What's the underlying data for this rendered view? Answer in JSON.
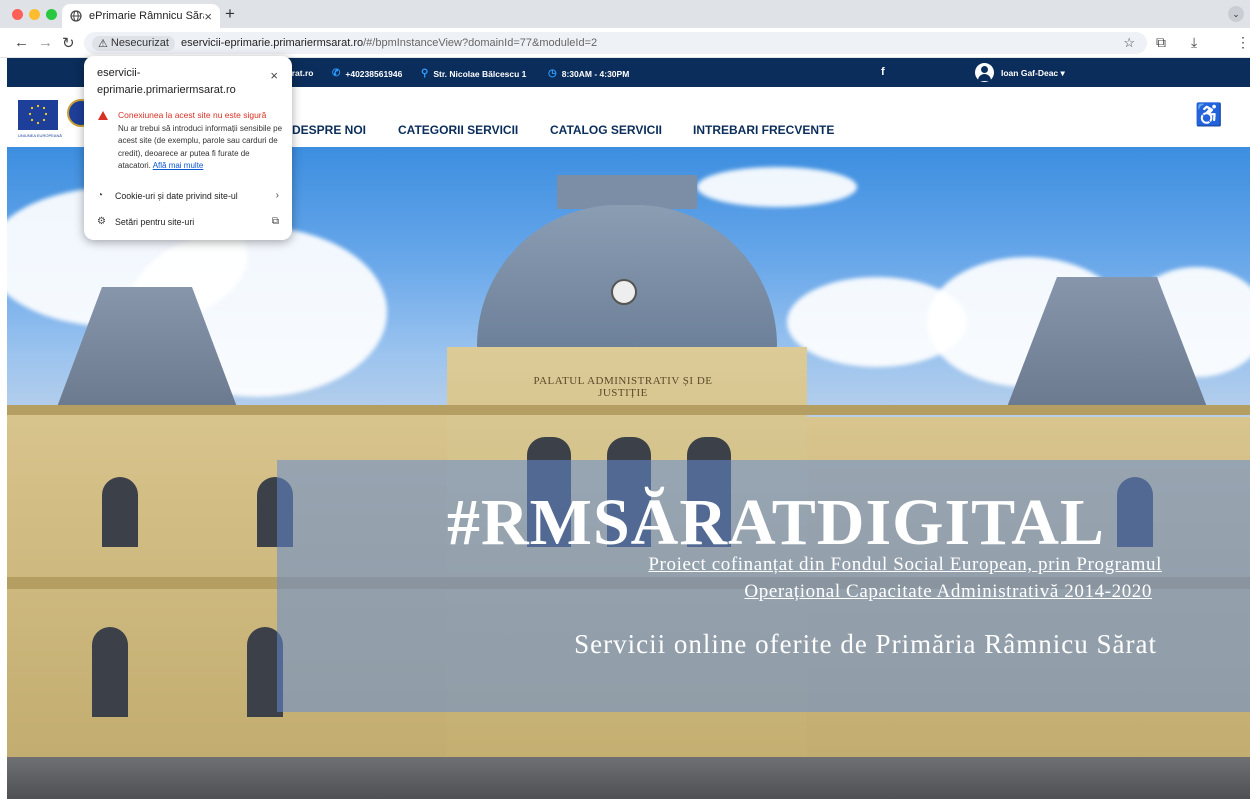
{
  "browser": {
    "tab_title": "ePrimarie Râmnicu Sărat",
    "new_tab_glyph": "+",
    "tab_close_glyph": "×",
    "security_chip": "Nesecurizat",
    "url_host": "eservicii-eprimarie.primariermsarat.ro",
    "url_rest": "/#/bpmInstanceView?domainId=77&moduleId=2",
    "icons": [
      "back-icon",
      "forward-icon",
      "reload-icon",
      "star-icon",
      "extensions-icon",
      "download-icon",
      "menu-icon"
    ]
  },
  "topbar": {
    "site_fragment": "arat.ro",
    "phone": "+40238561946",
    "address": "Str. Nicolae Bălcescu 1",
    "hours": "8:30AM - 4:30PM",
    "facebook": "f",
    "user_name": "Ioan Gaf-Deac",
    "user_caret": "▾"
  },
  "header": {
    "eu_caption": "UNIUNEA EUROPEANĂ",
    "nav": [
      "DESPRE NOI",
      "CATEGORII SERVICII",
      "CATALOG SERVICII",
      "INTREBARI FRECVENTE"
    ]
  },
  "hero": {
    "inscription": "PALATUL ADMINISTRATIV ȘI DE JUSTIȚIE",
    "title": "#RMSĂRATDIGITAL",
    "subtitle_line1": "Proiect cofinanțat din Fondul Social European, prin Programul",
    "subtitle_line2": "Operațional Capacitate Administrativă 2014-2020",
    "tagline": "Servicii online oferite de Primăria Râmnicu Sărat"
  },
  "popup": {
    "host": "eservicii-eprimarie.primariermsarat.ro",
    "close_glyph": "×",
    "warning_title": "Conexiunea la acest site nu este sigură",
    "warning_body": "Nu ar trebui să introduci informații sensibile pe acest site (de exemplu, parole sau carduri de credit), deoarece ar putea fi furate de atacatori.",
    "learn_more": "Află mai multe",
    "cookies_label": "Cookie-uri și date privind site-ul",
    "site_settings_label": "Setări pentru site-uri"
  },
  "colors": {
    "topbar_bg": "#0b2d5b",
    "accent_blue": "#2f9dff",
    "warning_red": "#d93025",
    "link_blue": "#0b57d0"
  }
}
